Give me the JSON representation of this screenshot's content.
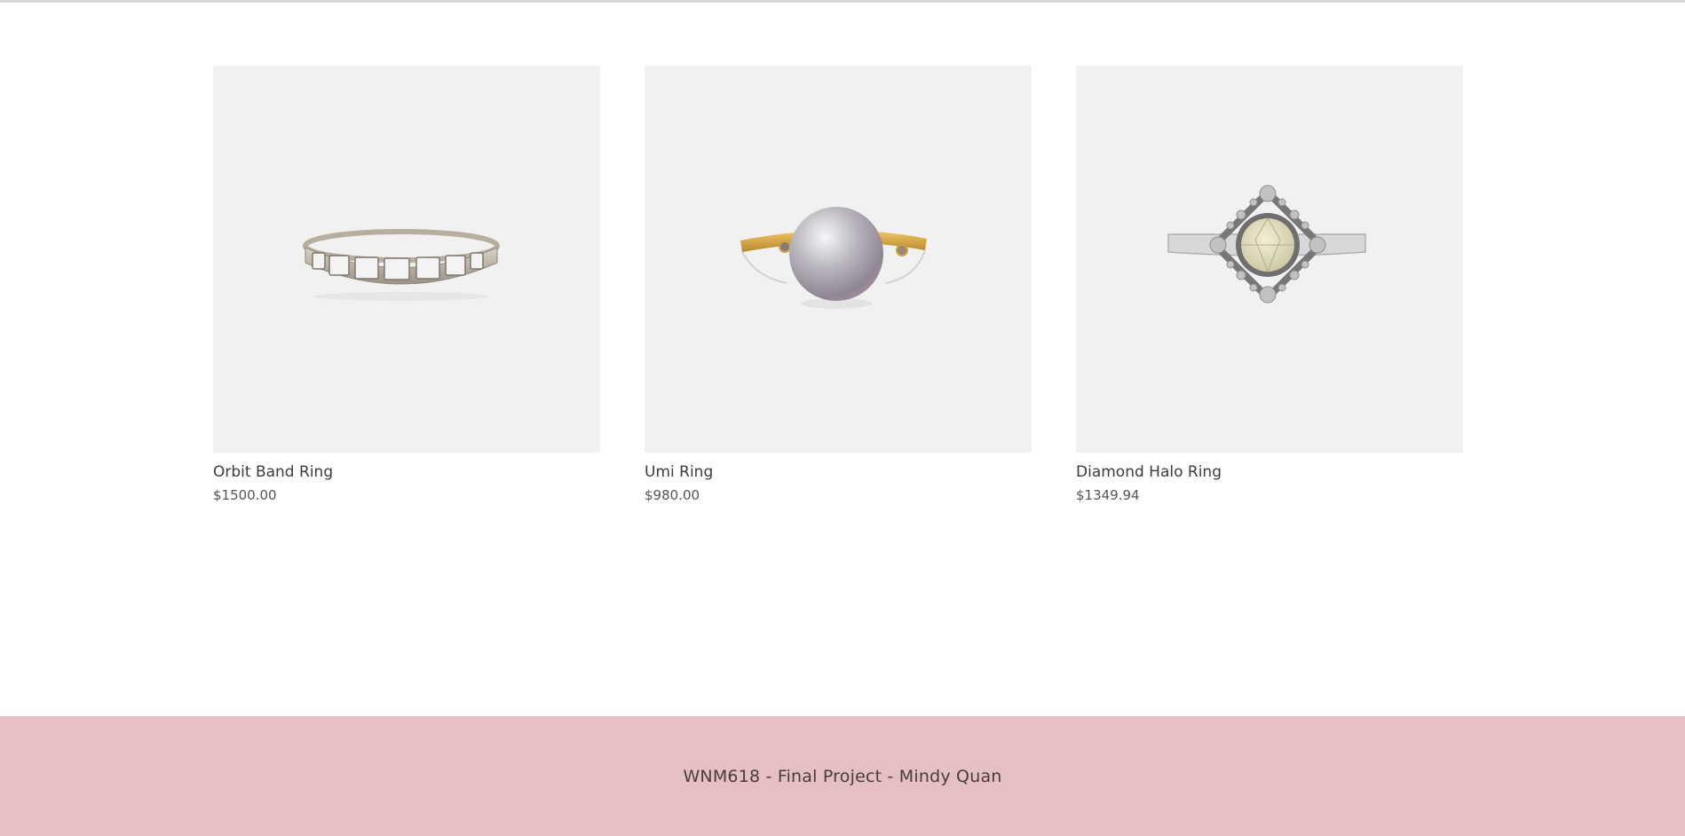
{
  "products": [
    {
      "name": "Orbit Band Ring",
      "price": "$1500.00",
      "image_icon": "baguette-band-ring-image"
    },
    {
      "name": "Umi Ring",
      "price": "$980.00",
      "image_icon": "pearl-ring-image"
    },
    {
      "name": "Diamond Halo Ring",
      "price": "$1349.94",
      "image_icon": "halo-ring-image"
    }
  ],
  "footer": {
    "text": "WNM618 - Final Project - Mindy Quan"
  },
  "colors": {
    "footer_bg": "#e5bfc1",
    "image_bg": "#f2f1f2",
    "text": "#3c3c3c"
  }
}
